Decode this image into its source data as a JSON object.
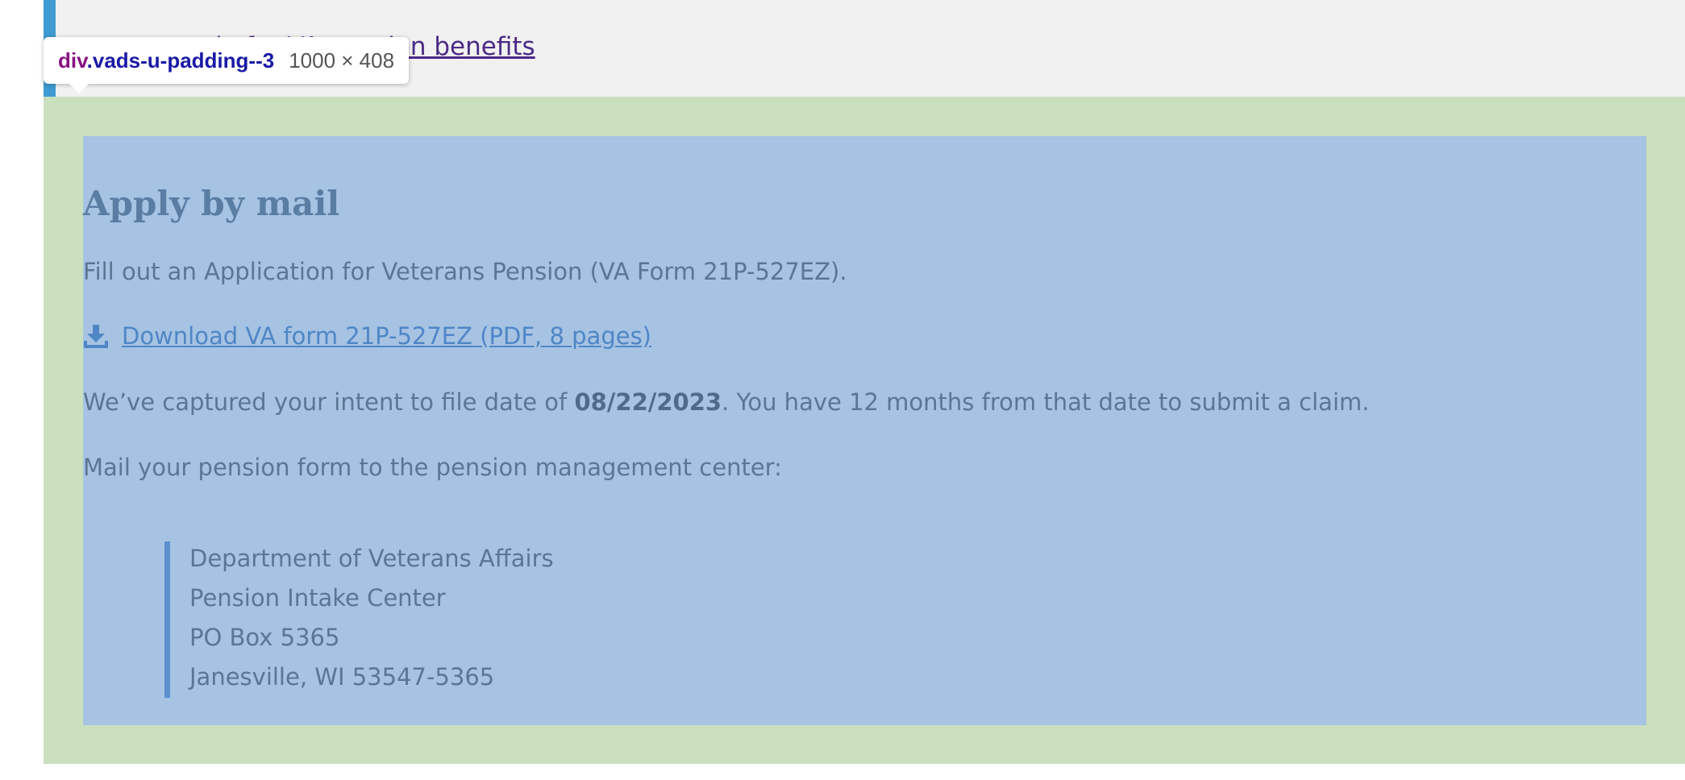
{
  "top": {
    "link_text": "o apply for VA pension benefits"
  },
  "devtools_tooltip": {
    "tag": "div",
    "class_name": ".vads-u-padding--3",
    "dimensions": "1000 × 408"
  },
  "section": {
    "heading": "Apply by mail",
    "intro": "Fill out an Application for Veterans Pension (VA Form 21P-527EZ).",
    "download": {
      "icon": "download-icon",
      "label": "Download VA form 21P-527EZ (PDF, 8 pages)"
    },
    "intent": {
      "before": "We’ve captured your intent to file date of ",
      "date": "08/22/2023",
      "after": ". You have 12 months from that date to submit a claim."
    },
    "mail_instruction": "Mail your pension form to the pension management center:",
    "address": [
      "Department of Veterans Affairs",
      "Pension Intake Center",
      "PO Box 5365",
      "Janesville, WI 53547-5365"
    ]
  },
  "colors": {
    "padding_highlight": "#cadfbe",
    "content_highlight": "#a6c3e3",
    "link": "#4f86c6",
    "accent_border": "#5b8fd0"
  }
}
